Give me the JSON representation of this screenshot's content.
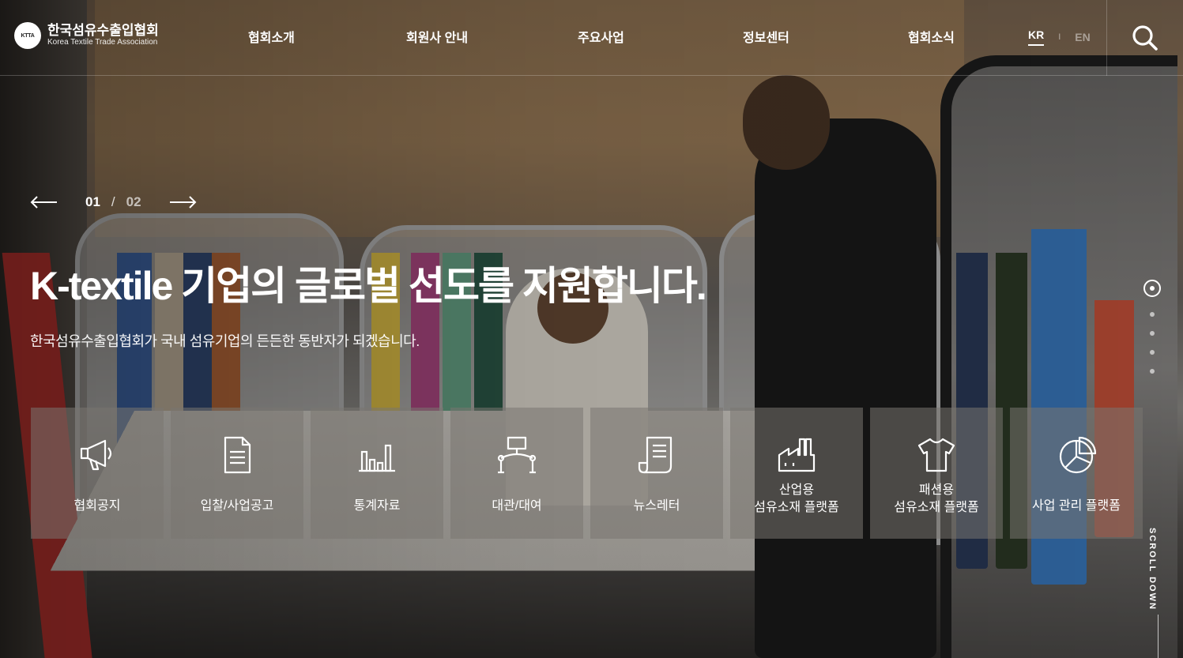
{
  "header": {
    "logo_mark": "KTTA",
    "logo_ko": "한국섬유수출입협회",
    "logo_en": "Korea Textile Trade Association",
    "nav": [
      "협회소개",
      "회원사 안내",
      "주요사업",
      "정보센터",
      "협회소식"
    ],
    "lang": {
      "kr": "KR",
      "sep": "I",
      "en": "EN"
    },
    "search_icon": "search-icon"
  },
  "slider": {
    "current": "01",
    "separator": "/",
    "total": "02",
    "prev_icon": "arrow-left-icon",
    "next_icon": "arrow-right-icon"
  },
  "hero": {
    "title": "K-textile 기업의 글로벌 선도를 지원합니다.",
    "subtitle": "한국섬유수출입협회가 국내 섬유기업의 든든한 동반자가 되겠습니다."
  },
  "tiles": [
    {
      "label": "협회공지",
      "icon": "megaphone-icon"
    },
    {
      "label": "입찰/사업공고",
      "icon": "document-icon"
    },
    {
      "label": "통계자료",
      "icon": "bar-chart-icon"
    },
    {
      "label": "대관/대여",
      "icon": "podium-icon"
    },
    {
      "label": "뉴스레터",
      "icon": "newsletter-icon"
    },
    {
      "label": "산업용\n섬유소재 플랫폼",
      "line1": "산업용",
      "line2": "섬유소재 플랫폼",
      "icon": "factory-icon"
    },
    {
      "label": "패션용\n섬유소재 플랫폼",
      "line1": "패션용",
      "line2": "섬유소재 플랫폼",
      "icon": "tshirt-icon"
    },
    {
      "label": "사업 관리 플랫폼",
      "icon": "pie-chart-icon"
    }
  ],
  "side_pager": {
    "count": 5,
    "active": 1
  },
  "scroll_down": "SCROLL DOWN"
}
